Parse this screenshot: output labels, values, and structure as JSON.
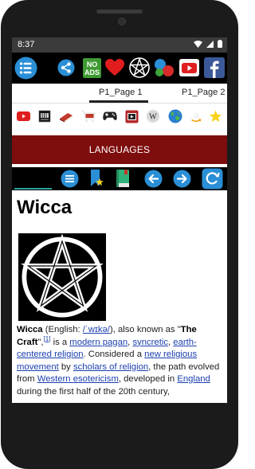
{
  "status": {
    "time": "8:37"
  },
  "toolbar": {
    "icons": [
      "menu-icon",
      "share-icon",
      "no-ads-icon",
      "heart-icon",
      "pentacle-icon",
      "bubbles-icon",
      "youtube-icon",
      "facebook-icon"
    ],
    "no_ads_top": "NO",
    "no_ads_bottom": "ADS"
  },
  "tabs": [
    {
      "label": "P1_Page 1"
    },
    {
      "label": "P1_Page 2"
    }
  ],
  "social_icons": [
    "youtube-icon",
    "imdb-icon",
    "book-icon",
    "cart-icon",
    "gamepad-icon",
    "video-icon",
    "wikipedia-icon",
    "globe-icon",
    "amazon-icon",
    "star-icon"
  ],
  "social": {
    "wiki_letter": "W",
    "amazon_letter": "a"
  },
  "languages": {
    "label": "LANGUAGES"
  },
  "navbar": {
    "icons": [
      "list-icon",
      "bookmark-star-icon",
      "book-icon",
      "back-arrow-icon",
      "forward-arrow-icon",
      "refresh-icon"
    ]
  },
  "article": {
    "title": "Wicca",
    "p1": "Wicca",
    "p2": " (English: ",
    "p3": "/ˈwɪkə/",
    "p4": "), also known as \"",
    "p5": "The Craft",
    "p6": "\",",
    "p7": "[1]",
    "p8": " is a ",
    "p9": "modern pagan",
    "p10": ", ",
    "p11": "syncretic",
    "p12": ", ",
    "p13": "earth-centered religion",
    "p14": ". Considered a ",
    "p15": "new religious movement",
    "p16": " by ",
    "p17": "scholars of religion",
    "p18": ", the path evolved from ",
    "p19": "Western esotericism",
    "p20": ", developed in ",
    "p21": "England",
    "p22": " during the first half of the 20th century,"
  },
  "colors": {
    "languages_bar": "#7e0d0d",
    "toolbar_bg": "#000000",
    "link": "#1a3fae",
    "status_bar": "#3b3b3b",
    "progress": "#2aa5a0"
  }
}
